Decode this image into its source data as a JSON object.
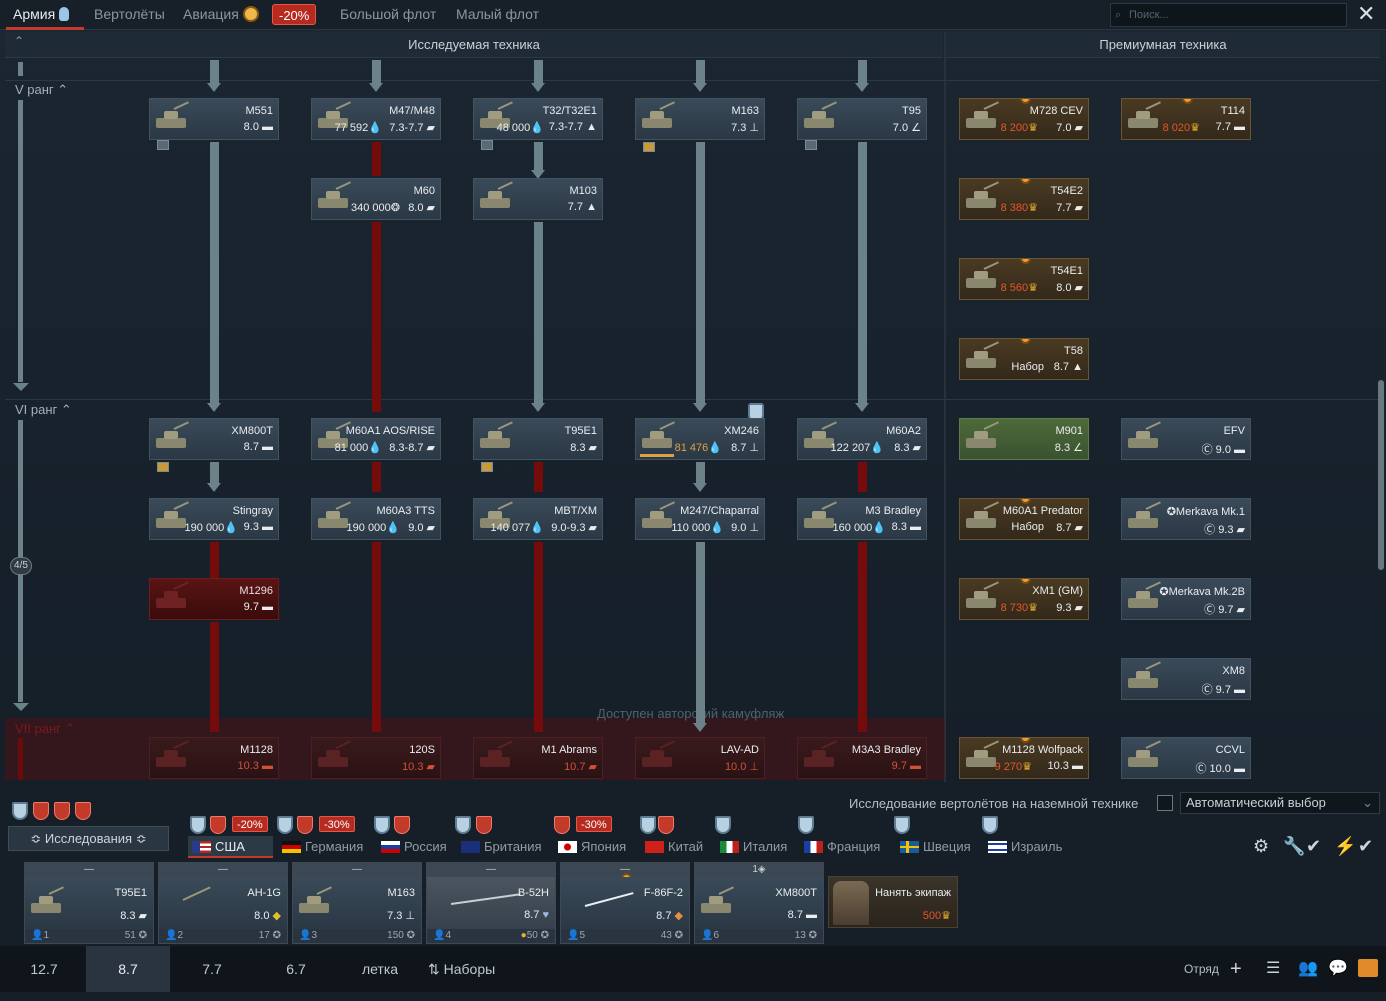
{
  "top_tabs": {
    "army": "Армия",
    "helicopters": "Вертолёты",
    "aviation": "Авиация",
    "discount": "-20%",
    "big_fleet": "Большой флот",
    "small_fleet": "Малый флот"
  },
  "search": {
    "placeholder": "Поиск..."
  },
  "headers": {
    "researched": "Исследуемая техника",
    "premium": "Премиумная техника"
  },
  "ranks": {
    "r5": "V ранг",
    "r6": "VI ранг",
    "r7": "VII ранг",
    "counter": "4/5"
  },
  "camo_notice": "Доступен авторский камуфляж",
  "research_cards": {
    "m551": {
      "name": "M551",
      "br": "8.0"
    },
    "m47": {
      "name": "M47/M48",
      "cost": "77 592",
      "br": "7.3-7.7"
    },
    "t32": {
      "name": "T32/T32E1",
      "cost": "48 000",
      "br": "7.3-7.7"
    },
    "m163": {
      "name": "M163",
      "br": "7.3"
    },
    "t95": {
      "name": "T95",
      "br": "7.0"
    },
    "m60": {
      "name": "M60",
      "cost": "340 000",
      "br": "8.0"
    },
    "m103": {
      "name": "M103",
      "br": "7.7"
    },
    "xm800t": {
      "name": "XM800T",
      "br": "8.7"
    },
    "m60a1aos": {
      "name": "M60A1 AOS/RISE",
      "cost": "81 000",
      "br": "8.3-8.7"
    },
    "t95e1": {
      "name": "T95E1",
      "br": "8.3"
    },
    "xm246": {
      "name": "XM246",
      "cost": "81 476",
      "br": "8.7"
    },
    "m60a2": {
      "name": "M60A2",
      "cost": "122 207",
      "br": "8.3"
    },
    "stingray": {
      "name": "Stingray",
      "cost": "190 000",
      "br": "9.3"
    },
    "m60a3": {
      "name": "M60A3 TTS",
      "cost": "190 000",
      "br": "9.0"
    },
    "mbtxm": {
      "name": "MBT/XM",
      "cost": "140 077",
      "br": "9.0-9.3"
    },
    "m247": {
      "name": "M247/Chaparral",
      "cost": "110 000",
      "br": "9.0"
    },
    "m3bradley": {
      "name": "M3 Bradley",
      "cost": "160 000",
      "br": "8.3"
    },
    "m1296": {
      "name": "M1296",
      "br": "9.7"
    },
    "m1128": {
      "name": "M1128",
      "br": "10.3"
    },
    "m120s": {
      "name": "120S",
      "br": "10.3"
    },
    "m1abrams": {
      "name": "M1 Abrams",
      "br": "10.7"
    },
    "lavad": {
      "name": "LAV-AD",
      "br": "10.0"
    },
    "m3a3": {
      "name": "M3A3 Bradley",
      "br": "9.7"
    }
  },
  "premium_cards": {
    "m728": {
      "name": "M728 CEV",
      "cost": "8 200",
      "br": "7.0"
    },
    "t114": {
      "name": "T114",
      "cost": "8 020",
      "br": "7.7"
    },
    "t54e2": {
      "name": "T54E2",
      "cost": "8 380",
      "br": "7.7"
    },
    "t54e1": {
      "name": "T54E1",
      "cost": "8 560",
      "br": "8.0"
    },
    "t58": {
      "name": "T58",
      "cost": "Набор",
      "br": "8.7"
    },
    "m901": {
      "name": "M901",
      "br": "8.3"
    },
    "efv": {
      "name": "EFV",
      "br": "9.0"
    },
    "m60predator": {
      "name": "M60A1 Predator",
      "cost": "Набор",
      "br": "8.7"
    },
    "merkava1": {
      "name": "Merkava Mk.1",
      "br": "9.3"
    },
    "xm1gm": {
      "name": "XM1 (GM)",
      "cost": "8 730",
      "br": "9.3"
    },
    "merkava2b": {
      "name": "Merkava Mk.2B",
      "br": "9.7"
    },
    "xm8": {
      "name": "XM8",
      "br": "9.7"
    },
    "wolfpack": {
      "name": "M1128 Wolfpack",
      "cost": "9 270",
      "br": "10.3"
    },
    "ccvl": {
      "name": "CCVL",
      "br": "10.0"
    }
  },
  "bottom_bar": {
    "heli_research": "Исследование вертолётов на наземной технике",
    "auto_select": "Автоматический выбор",
    "research_btn": "Исследования"
  },
  "nations": [
    {
      "name": "США",
      "discount": "-20%"
    },
    {
      "name": "Германия",
      "discount": "-30%"
    },
    {
      "name": "Россия"
    },
    {
      "name": "Британия"
    },
    {
      "name": "Япония",
      "discount": "-30%"
    },
    {
      "name": "Китай"
    },
    {
      "name": "Италия"
    },
    {
      "name": "Франция"
    },
    {
      "name": "Швеция"
    },
    {
      "name": "Израиль"
    }
  ],
  "crew_slots": [
    {
      "name": "T95E1",
      "br": "8.3",
      "idx": "1",
      "pts": "51"
    },
    {
      "name": "AH-1G",
      "br": "8.0",
      "idx": "2",
      "pts": "17"
    },
    {
      "name": "M163",
      "br": "7.3",
      "idx": "3",
      "pts": "150"
    },
    {
      "name": "B-52H",
      "br": "8.7",
      "idx": "4",
      "pts": "50"
    },
    {
      "name": "F-86F-2",
      "br": "8.7",
      "idx": "5",
      "pts": "43"
    },
    {
      "name": "XM800T",
      "br": "8.7",
      "idx": "6",
      "pts": "13",
      "top": "1"
    }
  ],
  "hire_crew": {
    "label": "Нанять экипаж",
    "cost": "500"
  },
  "br_tabs": [
    "12.7",
    "8.7",
    "7.7",
    "6.7",
    "летка"
  ],
  "presets": "Наборы",
  "squad": "Отряд"
}
